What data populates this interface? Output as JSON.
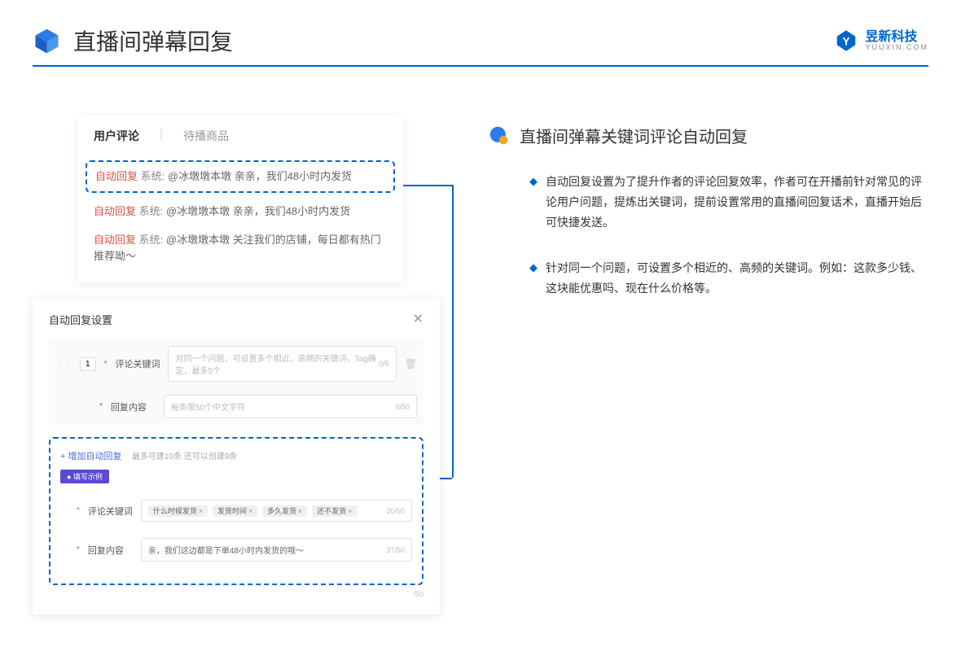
{
  "header": {
    "title": "直播间弹幕回复",
    "brand_name": "昱新科技",
    "brand_sub": "YUUXIN.COM"
  },
  "comments_card": {
    "tab_active": "用户评论",
    "tab_inactive": "待播商品",
    "lines": [
      {
        "label": "自动回复",
        "sys": "系统:",
        "text": "@冰墩墩本墩 亲亲，我们48小时内发货",
        "highlighted": true
      },
      {
        "label": "自动回复",
        "sys": "系统:",
        "text": "@冰墩墩本墩 亲亲，我们48小时内发货",
        "highlighted": false
      },
      {
        "label": "自动回复",
        "sys": "系统:",
        "text": "@冰墩墩本墩 关注我们的店铺，每日都有热门推荐呦～",
        "highlighted": false
      }
    ]
  },
  "settings": {
    "title": "自动回复设置",
    "index": "1",
    "keyword_label": "评论关键词",
    "keyword_placeholder": "对同一个问题，可设置多个相近、高频的关键词，Tag确定，最多5个",
    "keyword_count": "0/5",
    "content_label": "回复内容",
    "content_placeholder": "每条限50个中文字符",
    "content_count": "0/50",
    "add_link": "+ 增加自动回复",
    "limit_text": "最多可建10条 还可以创建9条",
    "example_badge": "● 填写示例",
    "ex_keyword_label": "评论关键词",
    "ex_tags": [
      "什么时候发货",
      "发货时间",
      "多久发货",
      "还不发货"
    ],
    "ex_keyword_count": "20/50",
    "ex_content_label": "回复内容",
    "ex_content_value": "亲，我们这边都是下单48小时内发货的哦～",
    "ex_content_count": "37/50",
    "trailing_count": "/50"
  },
  "right": {
    "title": "直播间弹幕关键词评论自动回复",
    "bullets": [
      "自动回复设置为了提升作者的评论回复效率，作者可在开播前针对常见的评论用户问题，提炼出关键词，提前设置常用的直播间回复话术，直播开始后可快捷发送。",
      "针对同一个问题，可设置多个相近的、高频的关键词。例如：这款多少钱、这块能优惠吗、现在什么价格等。"
    ]
  }
}
